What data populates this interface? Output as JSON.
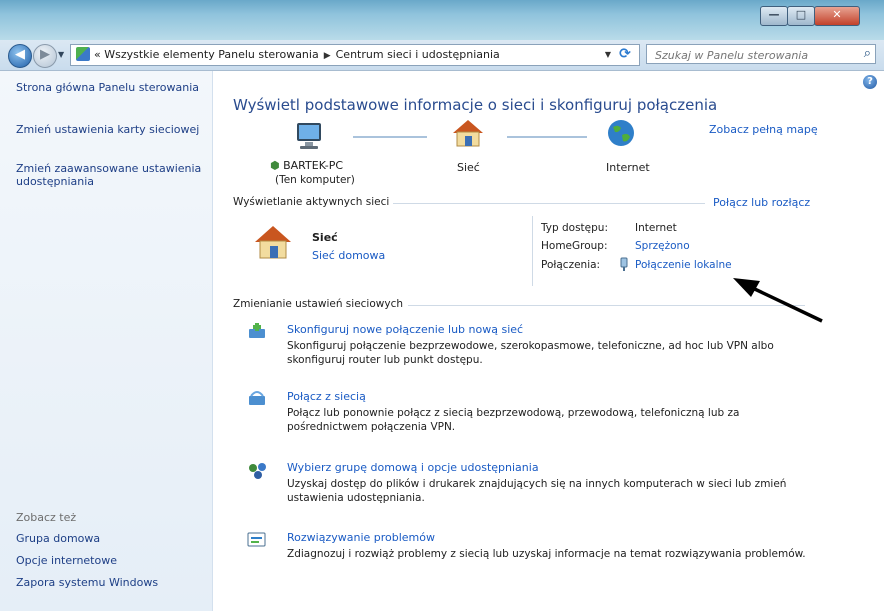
{
  "window": {
    "minimize": "—",
    "maximize": "□",
    "close": "✕"
  },
  "address": {
    "prefix": "«",
    "crumb1": "Wszystkie elementy Panelu sterowania",
    "crumb2": "Centrum sieci i udostępniania",
    "search_placeholder": "Szukaj w Panelu sterowania"
  },
  "sidebar": {
    "link1": "Strona główna Panelu sterowania",
    "link2": "Zmień ustawienia karty sieciowej",
    "link3": "Zmień zaawansowane ustawienia udostępniania",
    "see_also": "Zobacz też",
    "seealso1": "Grupa domowa",
    "seealso2": "Opcje internetowe",
    "seealso3": "Zapora systemu Windows"
  },
  "main": {
    "title": "Wyświetl podstawowe informacje o sieci i skonfiguruj połączenia",
    "full_map": "Zobacz pełną mapę",
    "map": {
      "computer": "BARTEK-PC",
      "computer_sub": "(Ten komputer)",
      "network": "Sieć",
      "internet": "Internet"
    },
    "active_section": "Wyświetlanie aktywnych sieci",
    "connect_disconnect": "Połącz lub rozłącz",
    "active_network": {
      "name": "Sieć",
      "type": "Sieć domowa"
    },
    "access_type_label": "Typ dostępu:",
    "access_type_value": "Internet",
    "homegroup_label": "HomeGroup:",
    "homegroup_value": "Sprzężono",
    "connections_label": "Połączenia:",
    "connections_value": "Połączenie lokalne",
    "change_section": "Zmienianie ustawień sieciowych",
    "tasks": [
      {
        "title": "Skonfiguruj nowe połączenie lub nową sieć",
        "desc": "Skonfiguruj połączenie bezprzewodowe, szerokopasmowe, telefoniczne, ad hoc lub VPN albo skonfiguruj router lub punkt dostępu."
      },
      {
        "title": "Połącz z siecią",
        "desc": "Połącz lub ponownie połącz z siecią bezprzewodową, przewodową, telefoniczną lub za pośrednictwem połączenia VPN."
      },
      {
        "title": "Wybierz grupę domową i opcje udostępniania",
        "desc": "Uzyskaj dostęp do plików i drukarek znajdujących się na innych komputerach w sieci lub zmień ustawienia udostępniania."
      },
      {
        "title": "Rozwiązywanie problemów",
        "desc": "Zdiagnozuj i rozwiąż problemy z siecią lub uzyskaj informacje na temat rozwiązywania problemów."
      }
    ]
  }
}
